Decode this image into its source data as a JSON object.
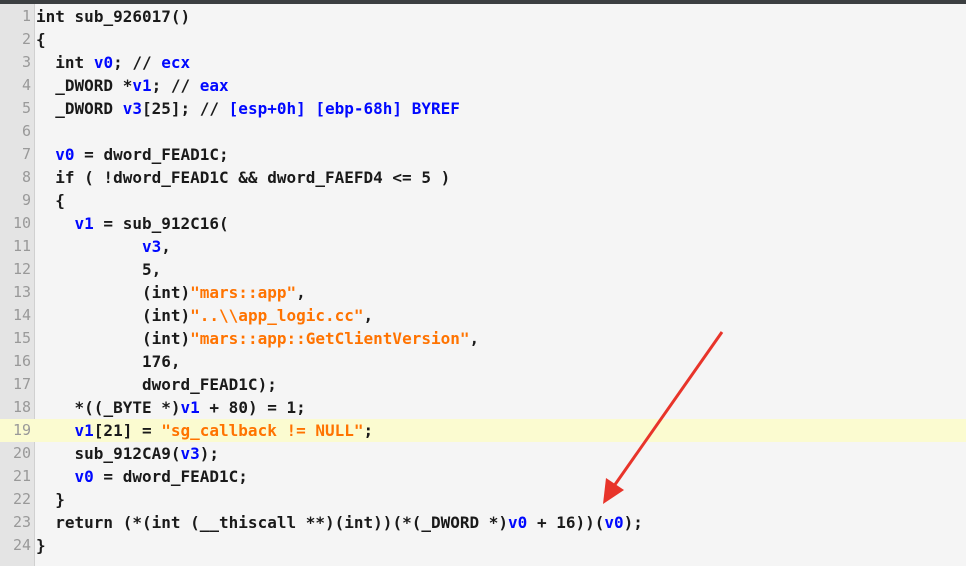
{
  "colors": {
    "string": "#ff7300",
    "variable": "#0008ff",
    "highlight": "#fbfbd0",
    "arrow": "#e8342a"
  },
  "lines": [
    {
      "n": "1",
      "t": "int sub_926017()"
    },
    {
      "n": "2",
      "t": "{"
    },
    {
      "n": "3",
      "t": "  int v0; // ecx"
    },
    {
      "n": "4",
      "t": "  _DWORD *v1; // eax"
    },
    {
      "n": "5",
      "t": "  _DWORD v3[25]; // [esp+0h] [ebp-68h] BYREF"
    },
    {
      "n": "6",
      "t": ""
    },
    {
      "n": "7",
      "t": "  v0 = dword_FEAD1C;"
    },
    {
      "n": "8",
      "t": "  if ( !dword_FEAD1C && dword_FAEFD4 <= 5 )"
    },
    {
      "n": "9",
      "t": "  {"
    },
    {
      "n": "10",
      "t": "    v1 = sub_912C16("
    },
    {
      "n": "11",
      "t": "           v3,"
    },
    {
      "n": "12",
      "t": "           5,"
    },
    {
      "n": "13",
      "t": "           (int)\"mars::app\","
    },
    {
      "n": "14",
      "t": "           (int)\"..\\\\app_logic.cc\","
    },
    {
      "n": "15",
      "t": "           (int)\"mars::app::GetClientVersion\","
    },
    {
      "n": "16",
      "t": "           176,"
    },
    {
      "n": "17",
      "t": "           dword_FEAD1C);"
    },
    {
      "n": "18",
      "t": "    *((_BYTE *)v1 + 80) = 1;"
    },
    {
      "n": "19",
      "t": "    v1[21] = \"sg_callback != NULL\";"
    },
    {
      "n": "20",
      "t": "    sub_912CA9(v3);"
    },
    {
      "n": "21",
      "t": "    v0 = dword_FEAD1C;"
    },
    {
      "n": "22",
      "t": "  }"
    },
    {
      "n": "23",
      "t": "  return (*(int (__thiscall **)(int))(*(_DWORD *)v0 + 16))(v0);"
    },
    {
      "n": "24",
      "t": "}"
    }
  ]
}
